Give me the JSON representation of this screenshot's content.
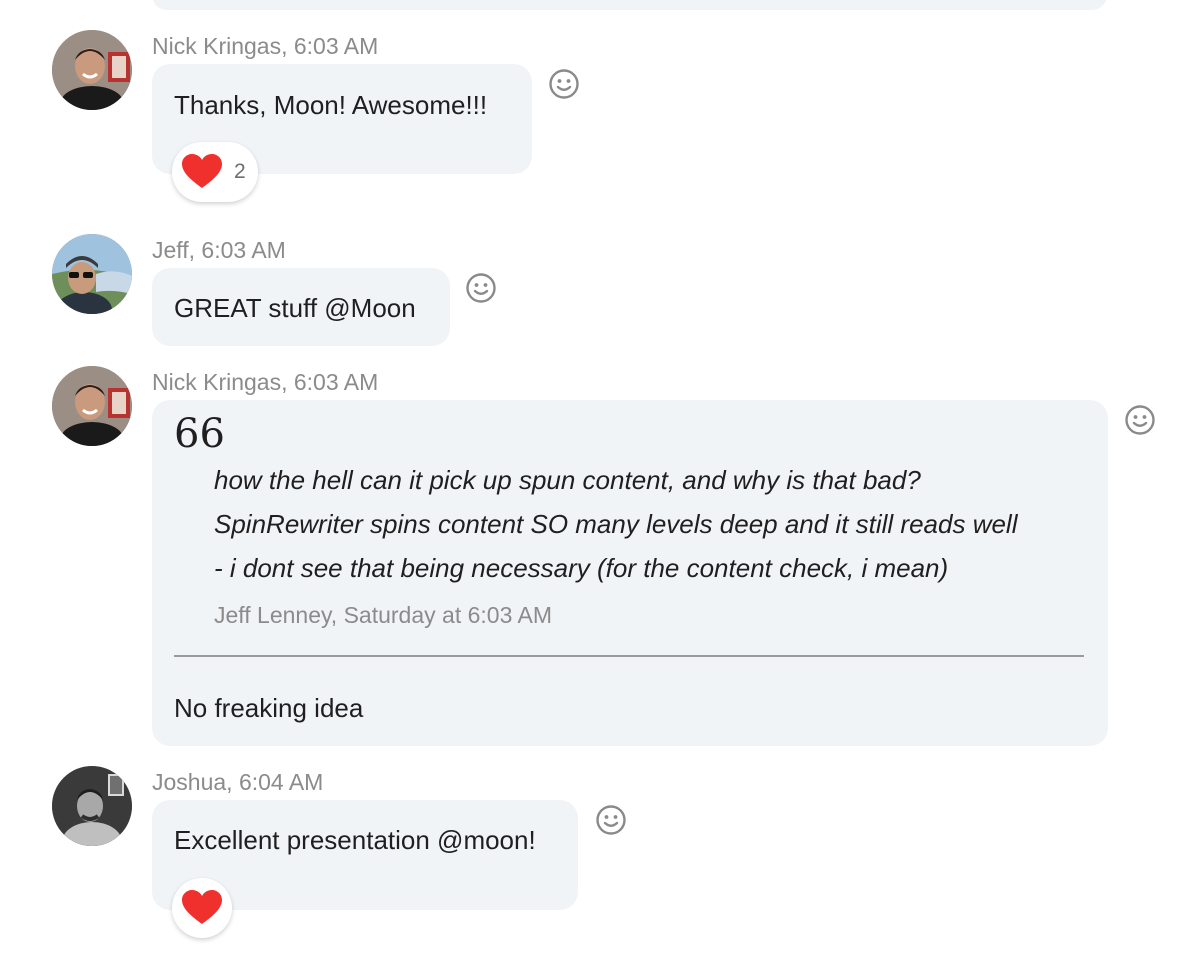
{
  "messages": [
    {
      "author": "Nick Kringas",
      "time": "6:03 AM",
      "meta": "Nick Kringas, 6:03 AM",
      "text": "Thanks, Moon! Awesome!!!",
      "reaction": {
        "icon": "heart-icon",
        "count": "2"
      }
    },
    {
      "author": "Jeff",
      "time": "6:03 AM",
      "meta": "Jeff, 6:03 AM",
      "text": "GREAT stuff @Moon"
    },
    {
      "author": "Nick Kringas",
      "time": "6:03 AM",
      "meta": "Nick Kringas, 6:03 AM",
      "quote": {
        "mark": "66",
        "lines": [
          "how the hell can it pick up spun content, and why is that bad?",
          "SpinRewriter spins content SO many levels deep and it still reads well",
          "- i dont see that being necessary (for the content check, i mean)"
        ],
        "attribution": "Jeff Lenney, Saturday at 6:03 AM"
      },
      "text": "No freaking idea"
    },
    {
      "author": "Joshua",
      "time": "6:04 AM",
      "meta": "Joshua, 6:04 AM",
      "text": "Excellent presentation @moon!",
      "reaction": {
        "icon": "heart-icon",
        "count": ""
      }
    }
  ],
  "colors": {
    "bubble": "#f1f4f7",
    "meta_text": "#8b8b8b",
    "heart": "#f0302c",
    "smiley": "#8a8a8a"
  }
}
